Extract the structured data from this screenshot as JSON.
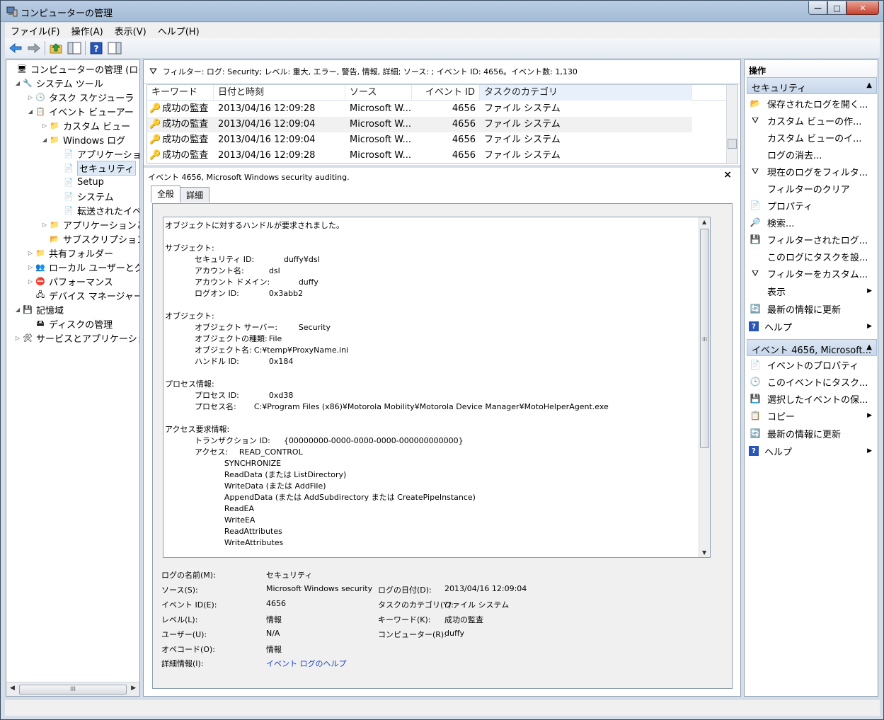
{
  "window": {
    "title": "コンピューターの管理",
    "buttons": {
      "minimize": "—",
      "maximize": "□",
      "close": "✕"
    }
  },
  "menu": [
    "ファイル(F)",
    "操作(A)",
    "表示(V)",
    "ヘルプ(H)"
  ],
  "toolbar": {
    "icons": [
      "back-icon",
      "forward-icon",
      "up-icon",
      "show-hide-tree-icon",
      "help-icon",
      "show-hide-action-icon"
    ]
  },
  "tree": [
    "コンピューターの管理 (ローカ",
    "システム ツール",
    "タスク スケジューラ",
    "イベント ビューアー",
    "カスタム ビュー",
    "Windows ログ",
    "アプリケーショ",
    "セキュリティ",
    "Setup",
    "システム",
    "転送されたイベ",
    "アプリケーションと",
    "サブスクリプション",
    "共有フォルダー",
    "ローカル ユーザーとグ",
    "パフォーマンス",
    "デバイス マネージャー",
    "記憶域",
    "ディスクの管理",
    "サービスとアプリケーショ"
  ],
  "filter": {
    "text": "フィルター: ログ: Security; レベル: 重大, エラー, 警告, 情報, 詳細; ソース: ; イベント ID: 4656。イベント数: 1,130"
  },
  "grid": {
    "columns": [
      "キーワード",
      "日付と時刻",
      "ソース",
      "イベント ID",
      "タスクのカテゴリ"
    ],
    "rows": [
      [
        "成功の監査",
        "2013/04/16 12:09:28",
        "Microsoft W...",
        "4656",
        "ファイル システム"
      ],
      [
        "成功の監査",
        "2013/04/16 12:09:04",
        "Microsoft W...",
        "4656",
        "ファイル システム"
      ],
      [
        "成功の監査",
        "2013/04/16 12:09:04",
        "Microsoft W...",
        "4656",
        "ファイル システム"
      ],
      [
        "成功の監査",
        "2013/04/16 12:09:28",
        "Microsoft W...",
        "4656",
        "ファイル システム"
      ]
    ]
  },
  "detail": {
    "title": "イベント 4656, Microsoft Windows security auditing.",
    "close": "×",
    "tabs": [
      "全般",
      "詳細"
    ],
    "message": "オブジェクトに対するハンドルが要求されました。\n\nサブジェクト:\n\t\tセキュリティ ID:\t\tduffy¥dsl\n\t\tアカウント名:\t\tdsl\n\t\tアカウント ドメイン:\t\tduffy\n\t\tログオン ID:\t\t0x3abb2\n\nオブジェクト:\n\t\tオブジェクト サーバー:\t\tSecurity\n\t\tオブジェクトの種類:\tFile\n\t\tオブジェクト名:\tC:¥temp¥ProxyName.ini\n\t\tハンドル ID:\t\t0x184\n\nプロセス情報:\n\t\tプロセス ID:\t\t0xd38\n\t\tプロセス名:\t\tC:¥Program Files (x86)¥Motorola Mobility¥Motorola Device Manager¥MotoHelperAgent.exe\n\nアクセス要求情報:\n\t\tトランザクション ID:\t{00000000-0000-0000-0000-000000000000}\n\t\tアクセス:\tREAD_CONTROL\n\t\t\t\tSYNCHRONIZE\n\t\t\t\tReadData (または ListDirectory)\n\t\t\t\tWriteData (または AddFile)\n\t\t\t\tAppendData (または AddSubdirectory または CreatePipeInstance)\n\t\t\t\tReadEA\n\t\t\t\tWriteEA\n\t\t\t\tReadAttributes\n\t\t\t\tWriteAttributes",
    "props": {
      "log_name_label": "ログの名前(M):",
      "log_name": "セキュリティ",
      "source_label": "ソース(S):",
      "source": "Microsoft Windows security a",
      "logged_label": "ログの日付(D):",
      "logged": "2013/04/16 12:09:04",
      "event_id_label": "イベント ID(E):",
      "event_id": "4656",
      "task_label": "タスクのカテゴリ(Y):",
      "task": "ファイル システム",
      "level_label": "レベル(L):",
      "level": "情報",
      "keywords_label": "キーワード(K):",
      "keywords": "成功の監査",
      "user_label": "ユーザー(U):",
      "user": "N/A",
      "computer_label": "コンピューター(R):",
      "computer": "duffy",
      "opcode_label": "オペコード(O):",
      "opcode": "情報",
      "more_label": "詳細情報(I):",
      "more_link": "イベント ログのヘルプ"
    }
  },
  "actions": {
    "header": "操作",
    "section1": "セキュリティ",
    "items1": [
      "保存されたログを開く...",
      "カスタム ビューの作...",
      "カスタム ビューのイ...",
      "ログの消去...",
      "現在のログをフィルタ...",
      "フィルターのクリア",
      "プロパティ",
      "検索...",
      "フィルターされたログ...",
      "このログにタスクを設...",
      "フィルターをカスタム...",
      "表示",
      "最新の情報に更新",
      "ヘルプ"
    ],
    "section2": "イベント 4656, Microsoft...",
    "items2": [
      "イベントのプロパティ",
      "このイベントにタスク...",
      "選択したイベントの保...",
      "コピー",
      "最新の情報に更新",
      "ヘルプ"
    ]
  },
  "scrollbar_grip": "III"
}
